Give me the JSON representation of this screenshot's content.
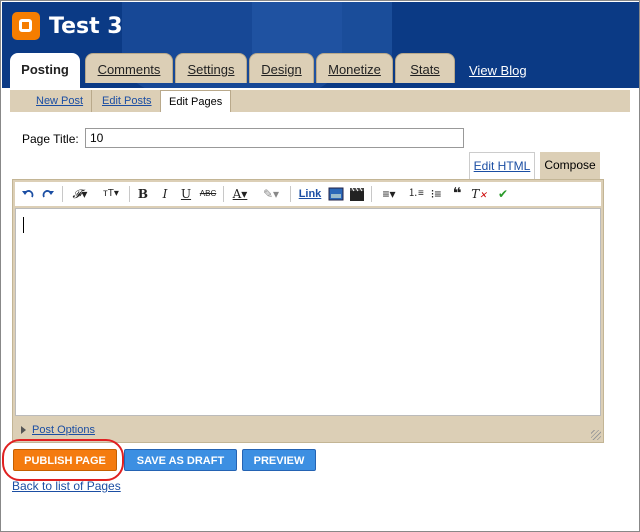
{
  "header": {
    "blog_title": "Test 3",
    "view_blog": "View Blog"
  },
  "tabs": [
    {
      "label": "Posting",
      "active": true
    },
    {
      "label": "Comments",
      "active": false
    },
    {
      "label": "Settings",
      "active": false
    },
    {
      "label": "Design",
      "active": false
    },
    {
      "label": "Monetize",
      "active": false
    },
    {
      "label": "Stats",
      "active": false
    }
  ],
  "subtabs": [
    {
      "label": "New Post"
    },
    {
      "label": "Edit Posts"
    },
    {
      "label": "Edit Pages",
      "active": true
    }
  ],
  "form": {
    "page_title_label": "Page Title:",
    "page_title_value": "10"
  },
  "editor_modes": {
    "edit_html": "Edit HTML",
    "compose": "Compose"
  },
  "toolbar": {
    "link_label": "Link"
  },
  "post_options": "Post Options",
  "buttons": {
    "publish": "PUBLISH PAGE",
    "save_draft": "SAVE AS DRAFT",
    "preview": "PREVIEW"
  },
  "back_link": "Back to list of Pages",
  "colors": {
    "header_bg": "#0b3a85",
    "tab_bg": "#dccfb6",
    "publish": "#f47b0f",
    "secondary": "#3c8fe2",
    "highlight": "#e02020"
  }
}
